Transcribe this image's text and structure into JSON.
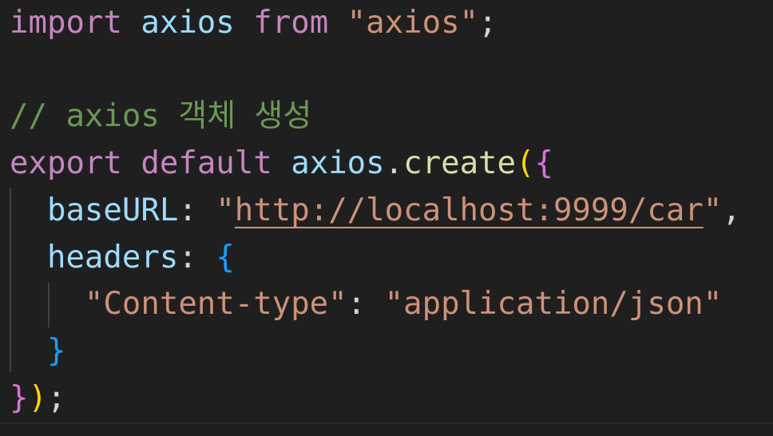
{
  "code": {
    "line1": {
      "kw_import": "import",
      "ident": " axios ",
      "kw_from": "from",
      "space": " ",
      "str": "\"axios\"",
      "punct": ";"
    },
    "line3": {
      "comment": "// axios 객체 생성"
    },
    "line4": {
      "kw_export": "export",
      "space1": " ",
      "kw_default": "default",
      "space2": " ",
      "ident": "axios",
      "dot": ".",
      "func": "create",
      "paren": "(",
      "brace": "{"
    },
    "line5": {
      "indent": "  ",
      "prop": "baseURL",
      "colon": ": ",
      "q_open": "\"",
      "url": "http://localhost:9999/car",
      "q_close": "\"",
      "comma": ","
    },
    "line6": {
      "indent": "  ",
      "prop": "headers",
      "colon": ": ",
      "brace": "{"
    },
    "line7": {
      "indent": "    ",
      "key": "\"Content-type\"",
      "colon": ": ",
      "value": "\"application/json\""
    },
    "line8": {
      "indent": "  ",
      "brace": "}"
    },
    "line9": {
      "brace": "}",
      "paren": ")",
      "semi": ";"
    }
  },
  "colors": {
    "background": "#1f1f1f",
    "keyword_control": "#c586c0",
    "keyword": "#569cd6",
    "identifier": "#9cdcfe",
    "function": "#dcdcaa",
    "string": "#ce9178",
    "comment": "#6a9955",
    "bracket_gold": "#ffd700",
    "bracket_purple": "#da70d6",
    "bracket_blue": "#179fff"
  }
}
